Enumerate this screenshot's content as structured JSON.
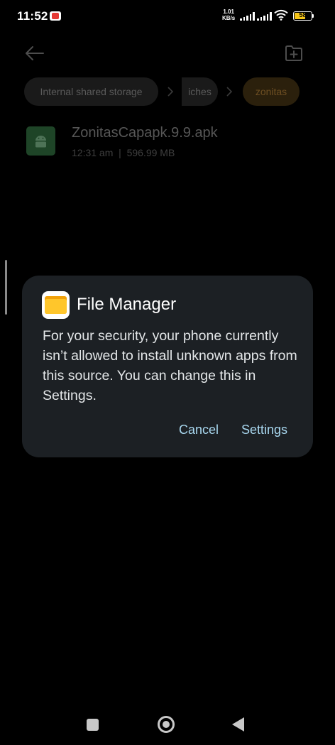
{
  "status_bar": {
    "time": "11:52",
    "net_speed_value": "1.01",
    "net_speed_unit": "KB/s",
    "battery": "58",
    "icons": [
      "youtube-icon",
      "signal-icon",
      "signal-icon",
      "wifi-icon",
      "battery-icon"
    ]
  },
  "toolbar": {
    "back_icon": "arrow-left-icon",
    "new_folder_icon": "new-folder-icon"
  },
  "breadcrumb": {
    "items": [
      "Internal shared storage",
      "iches",
      "zonitas"
    ],
    "separator_icon": "chevron-right-icon"
  },
  "file": {
    "name": "ZonitasCapapk.9.9.apk",
    "time": "12:31 am",
    "separator": "|",
    "size": "596.99 MB",
    "icon": "android-apk-icon"
  },
  "dialog": {
    "app_icon": "file-manager-folder-icon",
    "title": "File Manager",
    "message": "For your security, your phone currently isn’t allowed to install unknown apps from this source. You can change this in Settings.",
    "cancel_label": "Cancel",
    "settings_label": "Settings"
  },
  "nav_bar": {
    "icons": [
      "recents-square-icon",
      "home-circle-icon",
      "back-triangle-icon"
    ]
  },
  "colors": {
    "dialog_bg": "#1c2024",
    "button_text": "#a9d8f0",
    "battery": "#f6c518"
  }
}
